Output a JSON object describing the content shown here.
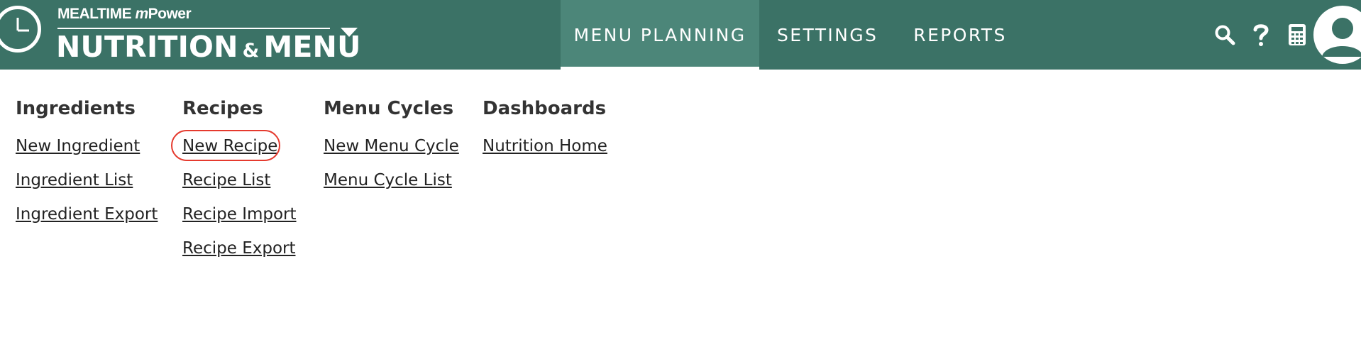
{
  "brand": {
    "top_prefix": "MEALTIME ",
    "top_m": "m",
    "top_suffix": "Power",
    "main_left": "NUTRITION",
    "main_amp": "&",
    "main_right": "MENU"
  },
  "nav": {
    "tabs": [
      {
        "label": "MENU PLANNING",
        "active": true
      },
      {
        "label": "SETTINGS",
        "active": false
      },
      {
        "label": "REPORTS",
        "active": false
      }
    ]
  },
  "tools": {
    "icons": [
      "search-icon",
      "help-icon",
      "calculator-icon",
      "user-avatar-icon"
    ]
  },
  "menu": {
    "columns": [
      {
        "heading": "Ingredients",
        "links": [
          "New Ingredient",
          "Ingredient List",
          "Ingredient Export"
        ]
      },
      {
        "heading": "Recipes",
        "links": [
          "New Recipe",
          "Recipe List",
          "Recipe Import",
          "Recipe Export"
        ]
      },
      {
        "heading": "Menu Cycles",
        "links": [
          "New Menu Cycle",
          "Menu Cycle List"
        ]
      },
      {
        "heading": "Dashboards",
        "links": [
          "Nutrition Home"
        ]
      }
    ],
    "highlighted_link": "New Recipe"
  },
  "colors": {
    "header_bg": "#3b7266",
    "active_tab_bg": "#4c8679",
    "highlight_ring": "#e53a2e"
  }
}
